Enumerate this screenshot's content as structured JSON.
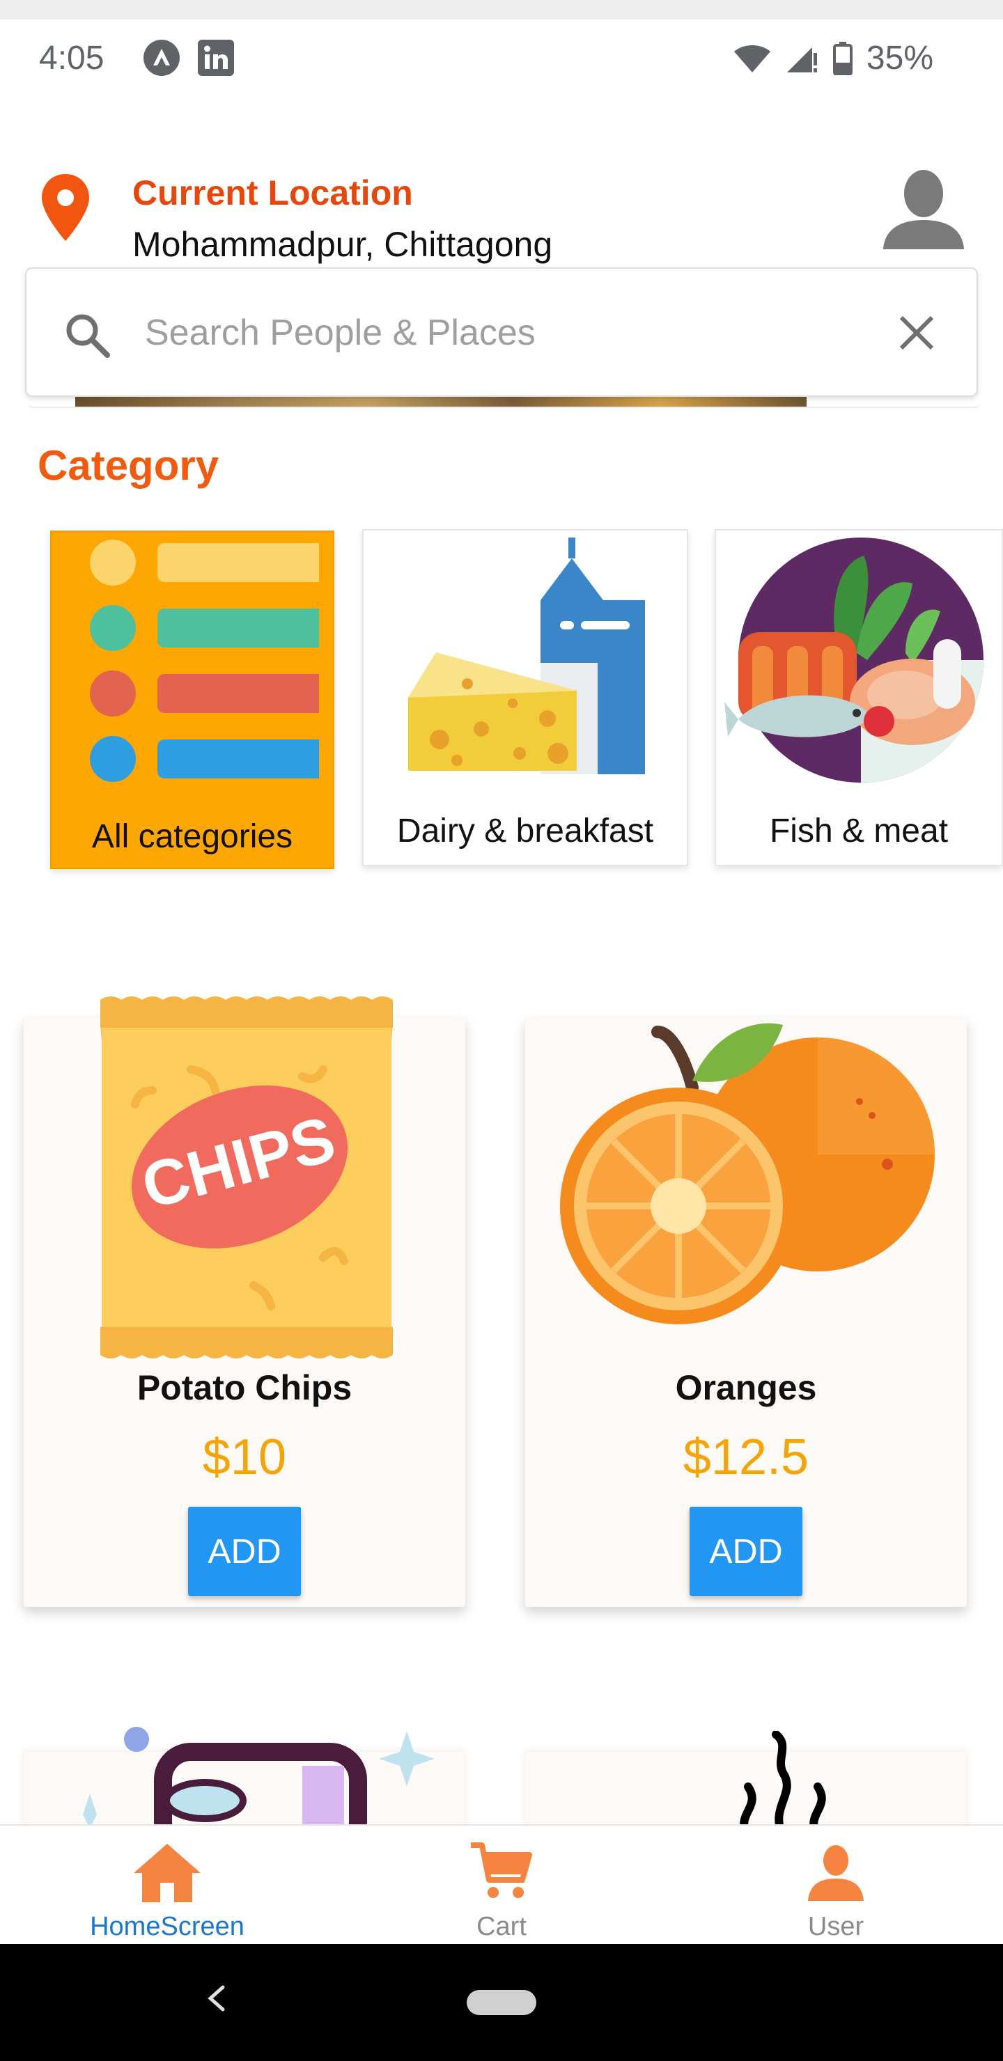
{
  "status_bar": {
    "time": "4:05",
    "battery": "35%",
    "icons": [
      "app-icon",
      "linkedin-icon",
      "wifi-icon",
      "signal-icon",
      "battery-icon"
    ]
  },
  "location": {
    "title": "Current Location",
    "value": "Mohammadpur, Chittagong"
  },
  "search": {
    "placeholder": "Search People & Places",
    "value": ""
  },
  "category": {
    "heading": "Category",
    "items": [
      {
        "label": "All categories",
        "selected": true
      },
      {
        "label": "Dairy & breakfast",
        "selected": false
      },
      {
        "label": "Fish & meat",
        "selected": false
      }
    ]
  },
  "products": [
    {
      "name": "Potato Chips",
      "price": "$10",
      "button": "ADD"
    },
    {
      "name": "Oranges",
      "price": "$12.5",
      "button": "ADD"
    }
  ],
  "bottom_nav": {
    "items": [
      {
        "label": "HomeScreen",
        "active": true
      },
      {
        "label": "Cart",
        "active": false
      },
      {
        "label": "User",
        "active": false
      }
    ]
  },
  "colors": {
    "accent_orange": "#f25a0d",
    "price": "#f4a405",
    "button_blue": "#2196f3",
    "nav_active": "#1976d2",
    "nav_icon": "#f58440"
  }
}
